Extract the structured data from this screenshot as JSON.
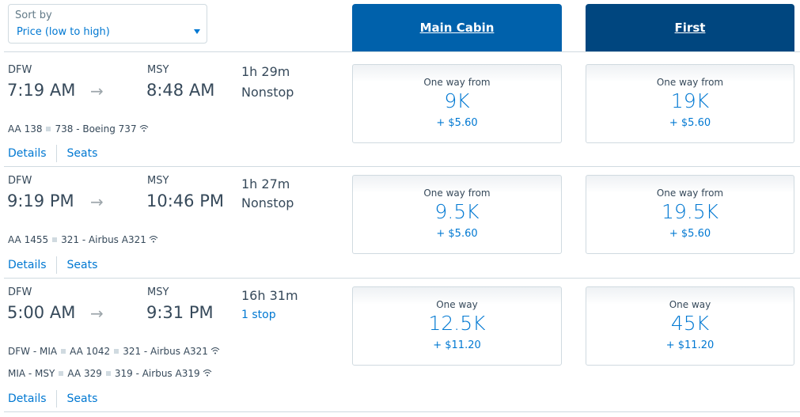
{
  "sort": {
    "label": "Sort by",
    "value": "Price (low to high)",
    "caret_icon": "caret-down-icon"
  },
  "cabins": [
    {
      "label": "Main Cabin",
      "color": "#0061ab"
    },
    {
      "label": "First",
      "color": "#00467f"
    }
  ],
  "flights": [
    {
      "origin": "DFW",
      "depart": "7:19 AM",
      "destination": "MSY",
      "arrive": "8:48 AM",
      "duration": "1h 29m",
      "stops": "Nonstop",
      "segments": [
        {
          "route": "",
          "flight": "AA 138",
          "aircraft": "738 - Boeing 737",
          "wifi": true
        }
      ],
      "details_label": "Details",
      "seats_label": "Seats",
      "fares": [
        {
          "label": "One way from",
          "miles": "9K",
          "tax": "+ $5.60"
        },
        {
          "label": "One way from",
          "miles": "19K",
          "tax": "+ $5.60"
        }
      ]
    },
    {
      "origin": "DFW",
      "depart": "9:19 PM",
      "destination": "MSY",
      "arrive": "10:46 PM",
      "duration": "1h 27m",
      "stops": "Nonstop",
      "segments": [
        {
          "route": "",
          "flight": "AA 1455",
          "aircraft": "321 - Airbus A321",
          "wifi": true
        }
      ],
      "details_label": "Details",
      "seats_label": "Seats",
      "fares": [
        {
          "label": "One way from",
          "miles": "9.5K",
          "tax": "+ $5.60"
        },
        {
          "label": "One way from",
          "miles": "19.5K",
          "tax": "+ $5.60"
        }
      ]
    },
    {
      "origin": "DFW",
      "depart": "5:00 AM",
      "destination": "MSY",
      "arrive": "9:31 PM",
      "duration": "16h 31m",
      "stops": "1 stop",
      "segments": [
        {
          "route": "DFW - MIA",
          "flight": "AA 1042",
          "aircraft": "321 - Airbus A321",
          "wifi": true
        },
        {
          "route": "MIA - MSY",
          "flight": "AA 329",
          "aircraft": "319 - Airbus A319",
          "wifi": true
        }
      ],
      "details_label": "Details",
      "seats_label": "Seats",
      "fares": [
        {
          "label": "One way",
          "miles": "12.5K",
          "tax": "+ $11.20"
        },
        {
          "label": "One way",
          "miles": "45K",
          "tax": "+ $11.20"
        }
      ]
    }
  ],
  "icons": {
    "arrow": "→",
    "wifi": "wifi-icon"
  }
}
